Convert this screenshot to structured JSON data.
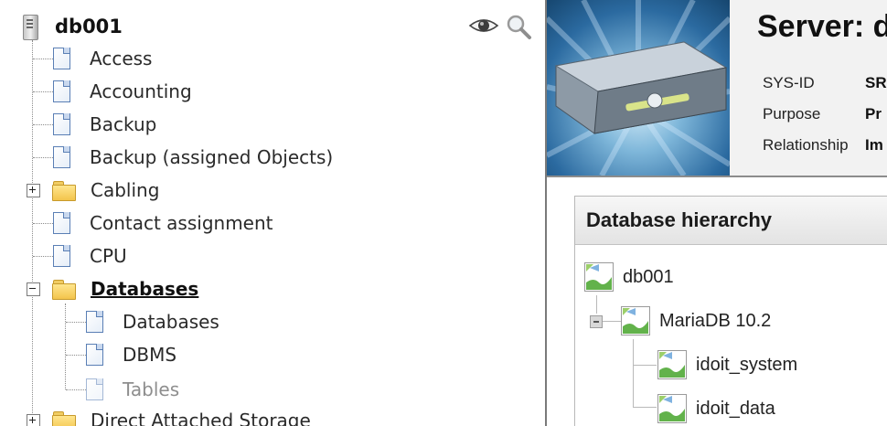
{
  "tree": {
    "root": {
      "label": "db001",
      "icon": "server-icon"
    },
    "tools": [
      {
        "icon": "eye-icon"
      },
      {
        "icon": "magnifier-icon"
      }
    ],
    "items": [
      {
        "label": "Access",
        "icon": "document-icon",
        "expander": "none",
        "state": "normal"
      },
      {
        "label": "Accounting",
        "icon": "document-icon",
        "expander": "none",
        "state": "normal"
      },
      {
        "label": "Backup",
        "icon": "document-icon",
        "expander": "none",
        "state": "normal"
      },
      {
        "label": "Backup (assigned Objects)",
        "icon": "document-icon",
        "expander": "none",
        "state": "normal"
      },
      {
        "label": "Cabling",
        "icon": "folder-icon",
        "expander": "plus",
        "state": "normal"
      },
      {
        "label": "Contact assignment",
        "icon": "document-icon",
        "expander": "none",
        "state": "normal"
      },
      {
        "label": "CPU",
        "icon": "document-icon",
        "expander": "none",
        "state": "normal"
      },
      {
        "label": "Databases",
        "icon": "folder-open-icon",
        "expander": "minus",
        "state": "active",
        "children": [
          {
            "label": "Databases",
            "icon": "document-icon",
            "state": "normal"
          },
          {
            "label": "DBMS",
            "icon": "document-icon",
            "state": "normal"
          },
          {
            "label": "Tables",
            "icon": "document-icon",
            "state": "muted"
          }
        ]
      },
      {
        "label": "Direct Attached Storage",
        "icon": "folder-icon",
        "expander": "plus",
        "state": "normal"
      }
    ]
  },
  "header": {
    "title": "Server: d",
    "info": [
      {
        "key": "SYS-ID",
        "value": "SR"
      },
      {
        "key": "Purpose",
        "value": "Pr"
      },
      {
        "key": "Relationship",
        "value": "Im"
      }
    ]
  },
  "hierarchy": {
    "title": "Database hierarchy",
    "nodes": [
      {
        "label": "db001",
        "icon": "image-placeholder-icon"
      },
      {
        "label": "MariaDB 10.2",
        "icon": "image-placeholder-icon"
      },
      {
        "label": "idoit_system",
        "icon": "image-placeholder-icon"
      },
      {
        "label": "idoit_data",
        "icon": "image-placeholder-icon"
      }
    ]
  },
  "colors": {
    "divider": "#7a7a7a",
    "folder": "#f3c44c",
    "doc_border": "#5a7fb5",
    "header_bg": "#f2f2f2",
    "device_bg": "#2b6aa0"
  }
}
